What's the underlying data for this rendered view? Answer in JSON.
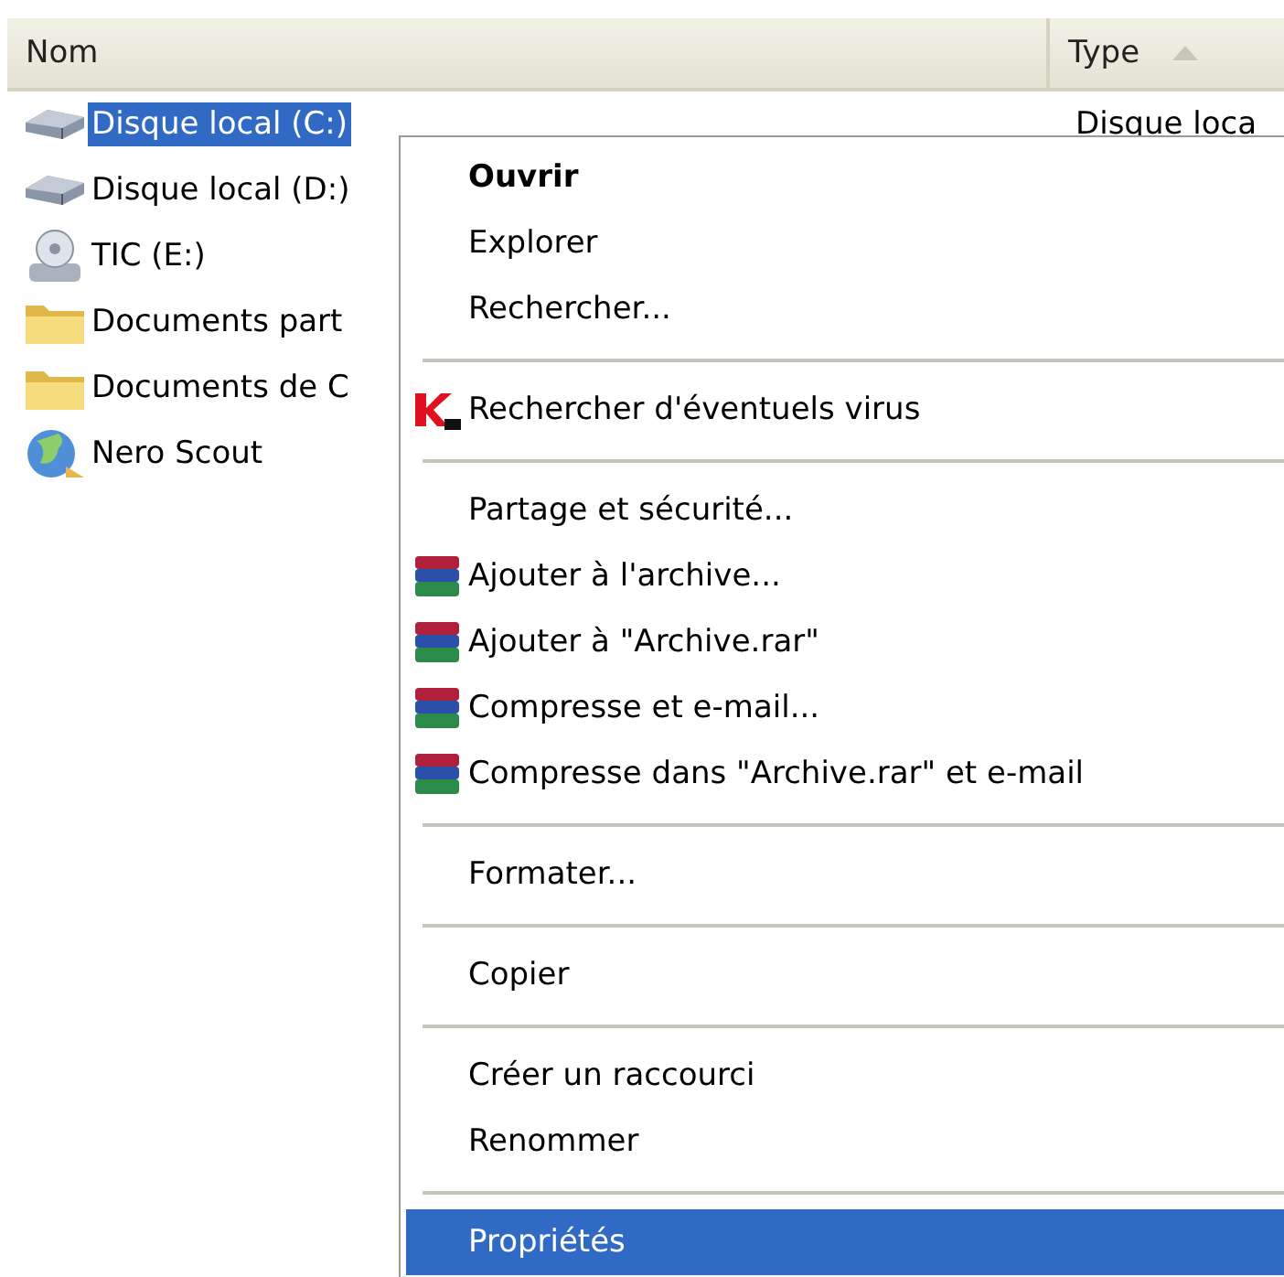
{
  "columns": [
    {
      "label": "Nom",
      "sorted": false
    },
    {
      "label": "Type",
      "sorted": true
    }
  ],
  "rows": [
    {
      "kind": "drive",
      "name": "Disque local (C:)",
      "type": "Disque loca",
      "selected": true
    },
    {
      "kind": "drive",
      "name": "Disque local (D:)",
      "selected": false
    },
    {
      "kind": "cd",
      "name": "TIC (E:)",
      "selected": false
    },
    {
      "kind": "folder",
      "name": "Documents part",
      "selected": false
    },
    {
      "kind": "folder",
      "name": "Documents de C",
      "selected": false
    },
    {
      "kind": "network",
      "name": "Nero Scout",
      "selected": false
    }
  ],
  "context_menu": [
    {
      "kind": "item",
      "label": "Ouvrir",
      "bold": true,
      "selected": false
    },
    {
      "kind": "item",
      "label": "Explorer",
      "bold": false,
      "selected": false
    },
    {
      "kind": "item",
      "label": "Rechercher...",
      "bold": false,
      "selected": false
    },
    {
      "kind": "separator"
    },
    {
      "kind": "antivirus",
      "label": "Rechercher d'éventuels virus",
      "bold": false,
      "selected": false
    },
    {
      "kind": "separator"
    },
    {
      "kind": "item",
      "label": "Partage et sécurité...",
      "bold": false,
      "selected": false
    },
    {
      "kind": "archive",
      "label": "Ajouter à l'archive...",
      "bold": false,
      "selected": false
    },
    {
      "kind": "archive",
      "label": "Ajouter à \"Archive.rar\"",
      "bold": false,
      "selected": false
    },
    {
      "kind": "archive",
      "label": "Compresse et e-mail...",
      "bold": false,
      "selected": false
    },
    {
      "kind": "archive",
      "label": "Compresse dans \"Archive.rar\" et e-mail",
      "bold": false,
      "selected": false
    },
    {
      "kind": "separator"
    },
    {
      "kind": "item",
      "label": "Formater...",
      "bold": false,
      "selected": false
    },
    {
      "kind": "separator"
    },
    {
      "kind": "item",
      "label": "Copier",
      "bold": false,
      "selected": false
    },
    {
      "kind": "separator"
    },
    {
      "kind": "item",
      "label": "Créer un raccourci",
      "bold": false,
      "selected": false
    },
    {
      "kind": "item",
      "label": "Renommer",
      "bold": false,
      "selected": false
    },
    {
      "kind": "separator"
    },
    {
      "kind": "item",
      "label": "Propriétés",
      "bold": false,
      "selected": true
    }
  ]
}
